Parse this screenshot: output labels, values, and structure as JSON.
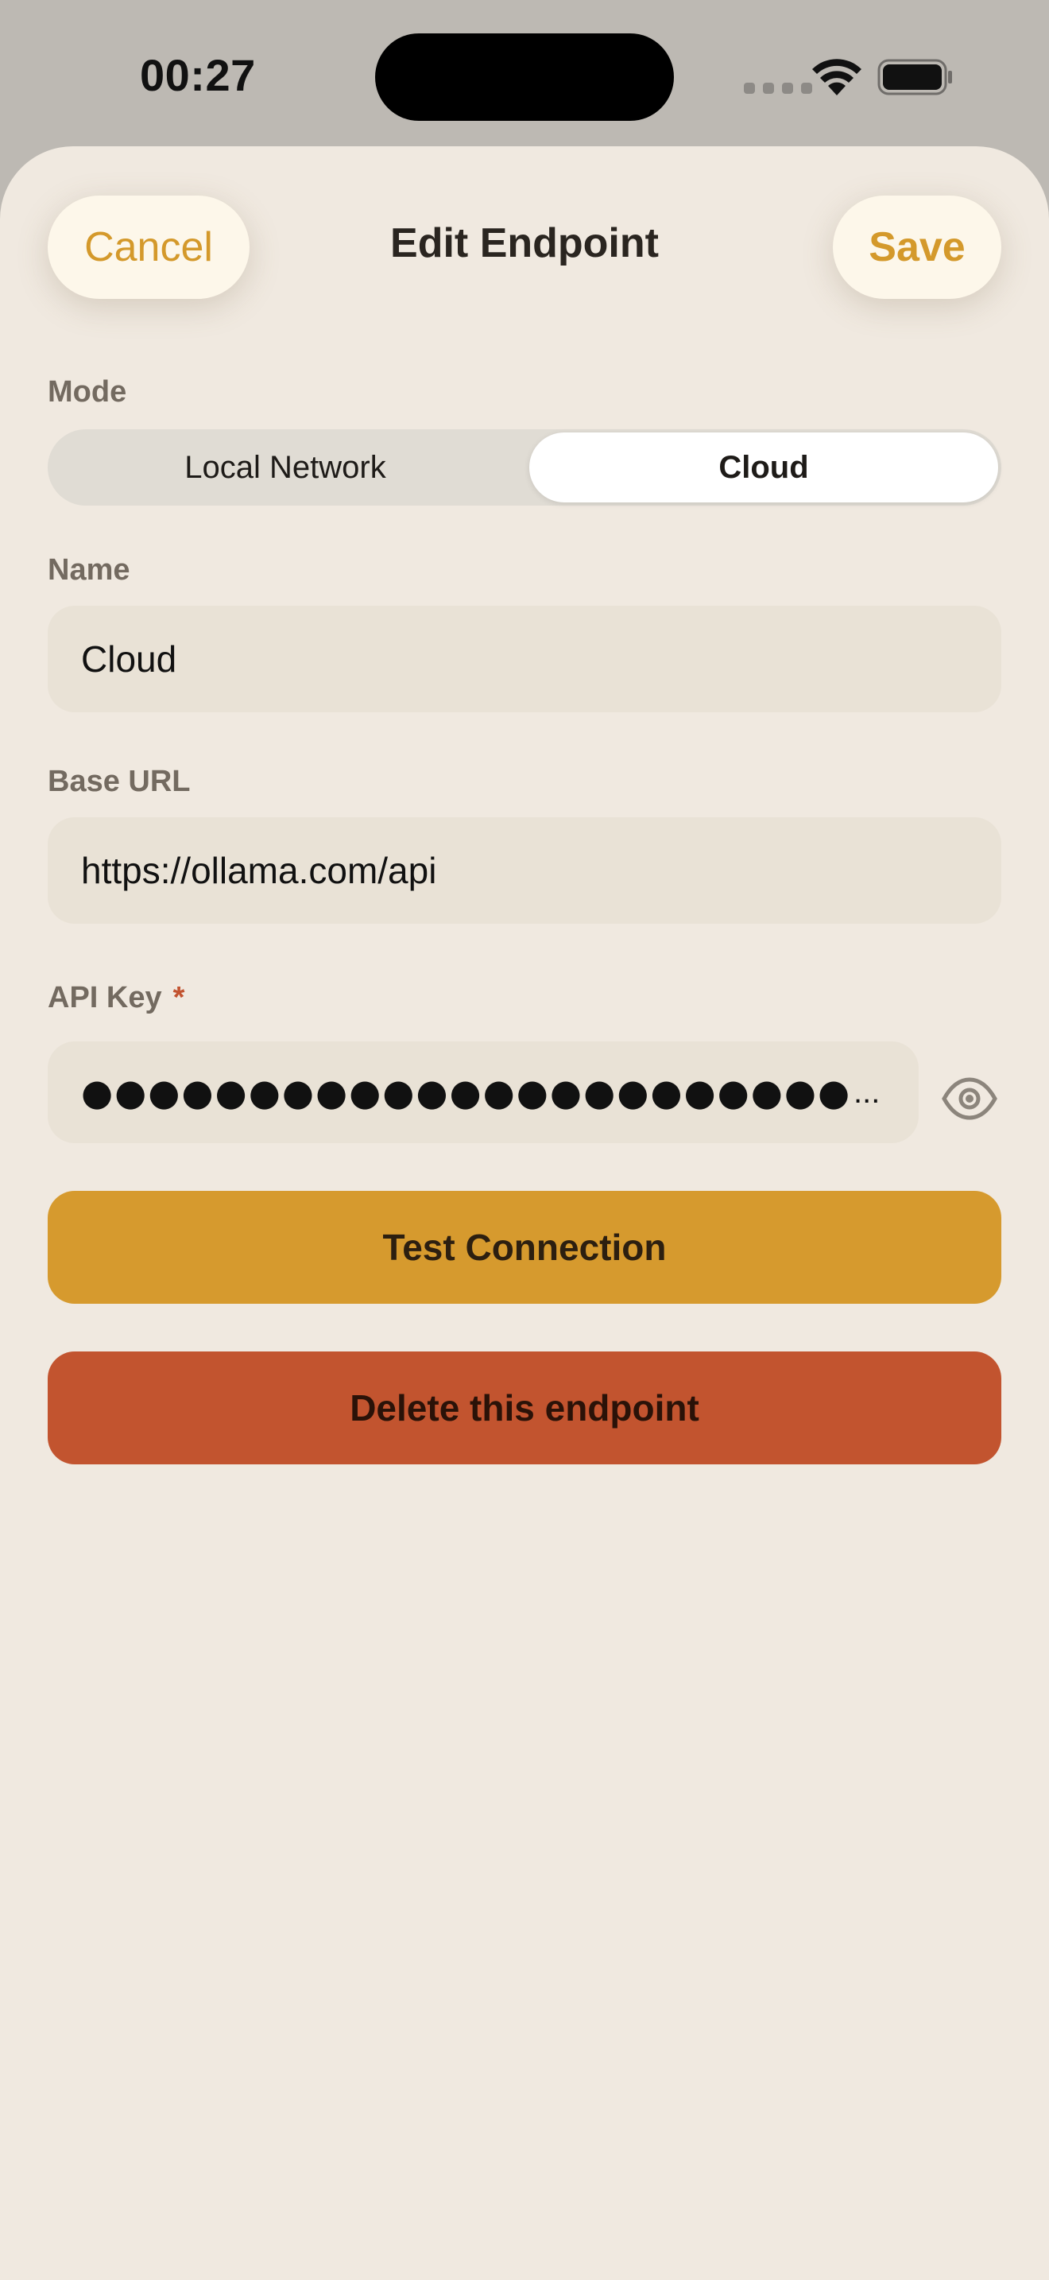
{
  "status_bar": {
    "time": "00:27"
  },
  "header": {
    "title": "Edit Endpoint",
    "cancel_label": "Cancel",
    "save_label": "Save"
  },
  "mode": {
    "label": "Mode",
    "options": [
      "Local Network",
      "Cloud"
    ],
    "selected": "Cloud"
  },
  "name_field": {
    "label": "Name",
    "value": "Cloud"
  },
  "base_url_field": {
    "label": "Base URL",
    "value": "https://ollama.com/api"
  },
  "api_key_field": {
    "label": "API Key",
    "required_marker": "*",
    "masked_value": "●●●●●●●●●●●●●●●●●●●●●●●●●●●●●●●●",
    "overflow": "...",
    "reveal_icon": "eye-icon"
  },
  "buttons": {
    "test_connection": "Test Connection",
    "delete_endpoint": "Delete this endpoint"
  },
  "colors": {
    "accent": "#d4992b",
    "test_button": "#d69a2e",
    "delete_button": "#c2542f",
    "background": "#f0e9e0"
  }
}
